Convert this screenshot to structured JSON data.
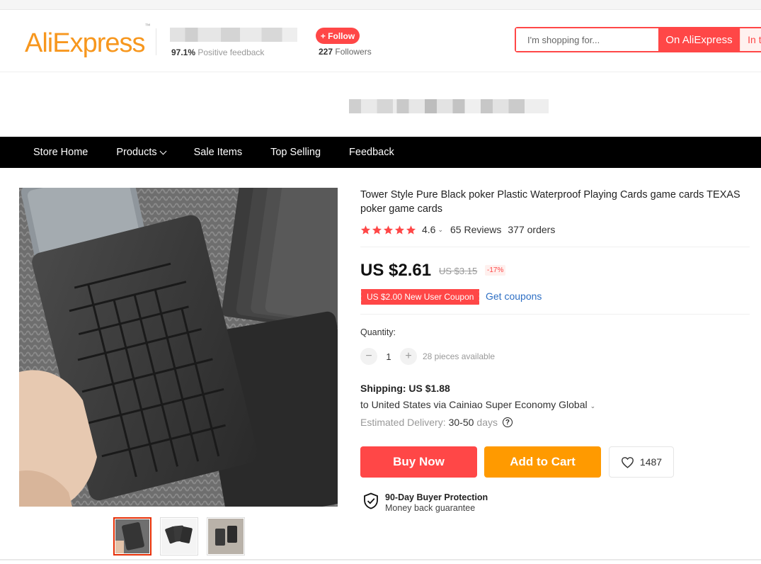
{
  "header": {
    "logo_text": "AliExpress",
    "logo_tm": "™",
    "positive_feedback_pct": "97.1%",
    "positive_feedback_label": "Positive feedback",
    "follow_label": "+ Follow",
    "followers_count": "227",
    "followers_label": "Followers",
    "search_placeholder": "I'm shopping for...",
    "search_btn_aliexpress": "On AliExpress",
    "search_btn_store": "In this store"
  },
  "nav": {
    "items": [
      "Store Home",
      "Products",
      "Sale Items",
      "Top Selling",
      "Feedback"
    ]
  },
  "product": {
    "title": "Tower Style Pure Black poker Plastic Waterproof Playing Cards game cards TEXAS poker game cards",
    "rating": "4.6",
    "rating_stars": 5,
    "reviews": "65 Reviews",
    "orders": "377 orders",
    "price": "US $2.61",
    "old_price": "US $3.15",
    "discount": "-17%",
    "coupon": "US $2.00 New User Coupon",
    "get_coupons": "Get coupons",
    "quantity_label": "Quantity:",
    "quantity_value": "1",
    "quantity_minus": "−",
    "quantity_plus": "+",
    "pieces_available": "28 pieces available",
    "shipping_title": "Shipping: US $1.88",
    "shipping_route": "to United States via Cainiao Super Economy Global",
    "estimated_label": "Estimated Delivery:",
    "estimated_value": "30-50",
    "estimated_unit": "days",
    "buy_now": "Buy Now",
    "add_to_cart": "Add to Cart",
    "wishlist_count": "1487",
    "protection_title": "90-Day Buyer Protection",
    "protection_sub": "Money back guarantee"
  },
  "colors": {
    "brand_red": "#ff4747",
    "brand_orange": "#ff9a00",
    "nav_bg": "#000000",
    "link_blue": "#2e6fc4",
    "star_red": "#ff4747"
  }
}
